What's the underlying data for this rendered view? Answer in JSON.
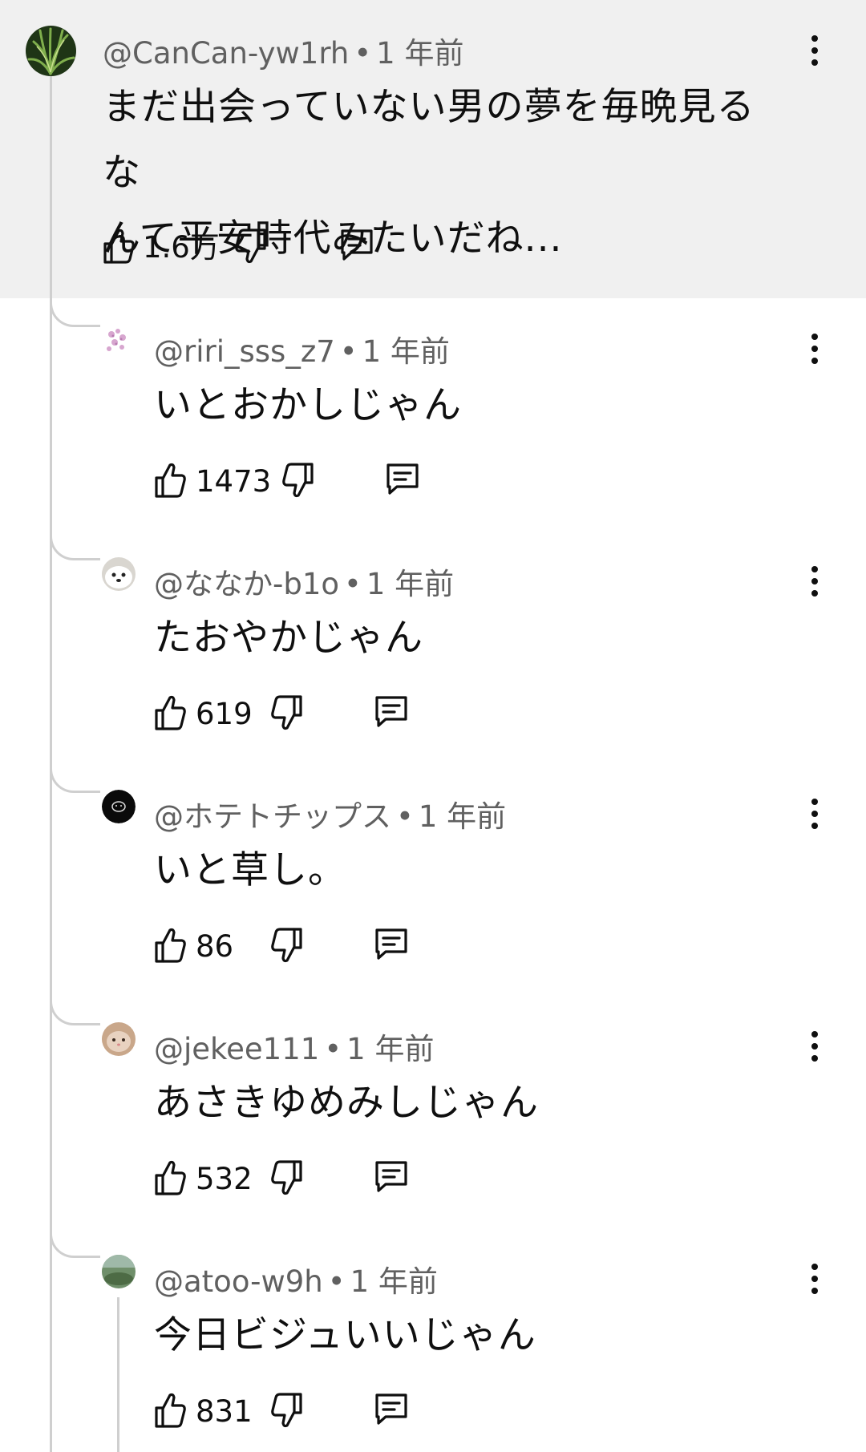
{
  "comments": [
    {
      "handle": "@CanCan-yw1rh",
      "time": "1 年前",
      "text_lines": [
        "まだ出会っていない男の夢を毎晩見るな",
        "んて平安時代みたいだね..."
      ],
      "likes": "1.6万",
      "avatar": "plant"
    },
    {
      "handle": "@riri_sss_z7",
      "time": "1 年前",
      "text_lines": [
        "いとおかしじゃん"
      ],
      "likes": "1473",
      "avatar": "flowers"
    },
    {
      "handle": "@ななか-b1o",
      "time": "1 年前",
      "text_lines": [
        "たおやかじゃん"
      ],
      "likes": "619",
      "avatar": "dog"
    },
    {
      "handle": "@ホテトチップス",
      "time": "1 年前",
      "text_lines": [
        "いと草し。"
      ],
      "likes": "86",
      "avatar": "black-circle"
    },
    {
      "handle": "@jekee111",
      "time": "1 年前",
      "text_lines": [
        "あさきゆめみしじゃん"
      ],
      "likes": "532",
      "avatar": "cat"
    },
    {
      "handle": "@atoo-w9h",
      "time": "1 年前",
      "text_lines": [
        "今日ビジュいいじゃん"
      ],
      "likes": "831",
      "avatar": "landscape"
    }
  ],
  "colors": {
    "top_bg": "#f0f0f0",
    "text": "#0f0f0f",
    "meta": "#606060",
    "thread_line": "#cfcfcf"
  },
  "icons": [
    "thumb-up-icon",
    "thumb-down-icon",
    "reply-icon",
    "more-vert-icon"
  ]
}
